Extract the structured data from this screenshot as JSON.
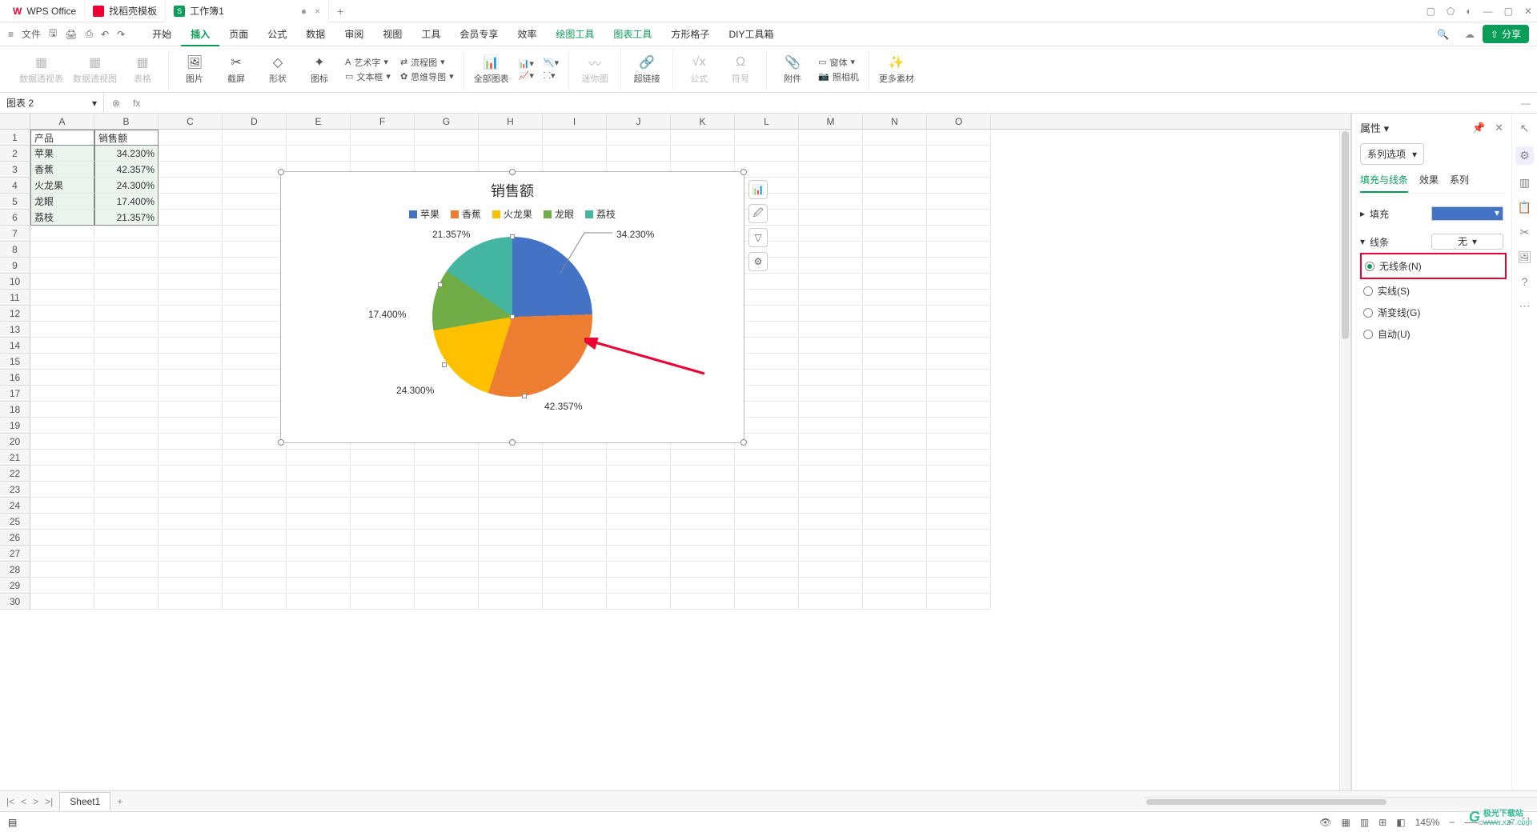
{
  "titlebar": {
    "app_name": "WPS Office",
    "template_tab": "找稻壳模板",
    "doc_tab": "工作簿1",
    "doc_badge": "S",
    "plus": "+"
  },
  "menubar": {
    "file": "文件",
    "tabs": [
      "开始",
      "插入",
      "页面",
      "公式",
      "数据",
      "审阅",
      "视图",
      "工具",
      "会员专享",
      "效率",
      "绘图工具",
      "图表工具",
      "方形格子",
      "DIY工具箱"
    ],
    "active_index": 1,
    "highlight_indices": [
      10,
      11
    ],
    "share": "分享"
  },
  "ribbon": {
    "pivot_table": "数据透视表",
    "pivot_chart": "数据透视图",
    "table": "表格",
    "picture": "图片",
    "screenshot": "截屏",
    "shapes": "形状",
    "icons": "图标",
    "wordart": "艺术字",
    "textbox": "文本框",
    "flowchart": "流程图",
    "mindmap": "思维导图",
    "all_charts": "全部图表",
    "mini_chart": "迷你图",
    "hyperlink": "超链接",
    "formula": "公式",
    "symbol": "符号",
    "attachment": "附件",
    "object": "窗体",
    "camera": "照相机",
    "more": "更多素材"
  },
  "formula": {
    "name_box": "图表 2",
    "fx": "fx"
  },
  "sheet": {
    "cols": [
      "A",
      "B",
      "C",
      "D",
      "E",
      "F",
      "G",
      "H",
      "I",
      "J",
      "K",
      "L",
      "M",
      "N",
      "O"
    ],
    "row_count": 30,
    "headers": [
      "产品",
      "销售额"
    ],
    "data": [
      [
        "苹果",
        "34.230%"
      ],
      [
        "香蕉",
        "42.357%"
      ],
      [
        "火龙果",
        "24.300%"
      ],
      [
        "龙眼",
        "17.400%"
      ],
      [
        "荔枝",
        "21.357%"
      ]
    ]
  },
  "chart_data": {
    "type": "pie",
    "title": "销售额",
    "series": [
      {
        "name": "苹果",
        "value": 34.23,
        "label": "34.230%",
        "color": "#4472c4"
      },
      {
        "name": "香蕉",
        "value": 42.357,
        "label": "42.357%",
        "color": "#ed7d31"
      },
      {
        "name": "火龙果",
        "value": 24.3,
        "label": "24.300%",
        "color": "#ffc000"
      },
      {
        "name": "龙眼",
        "value": 17.4,
        "label": "17.400%",
        "color": "#70ad47"
      },
      {
        "name": "荔枝",
        "value": 21.357,
        "label": "21.357%",
        "color": "#43b5a0"
      }
    ],
    "legend_position": "top"
  },
  "panel": {
    "title": "属性",
    "series_dropdown": "系列选项",
    "tabs": [
      "填充与线条",
      "效果",
      "系列"
    ],
    "active_tab": 0,
    "fill_label": "填充",
    "line_label": "线条",
    "line_value": "无",
    "radios": [
      {
        "label": "无线条(N)",
        "checked": true
      },
      {
        "label": "实线(S)",
        "checked": false
      },
      {
        "label": "渐变线(G)",
        "checked": false
      },
      {
        "label": "自动(U)",
        "checked": false
      }
    ]
  },
  "sheet_tabs": {
    "sheet1": "Sheet1"
  },
  "status": {
    "zoom": "145%"
  },
  "watermark": {
    "name": "极光下载站",
    "url": "www.xz7.com"
  }
}
